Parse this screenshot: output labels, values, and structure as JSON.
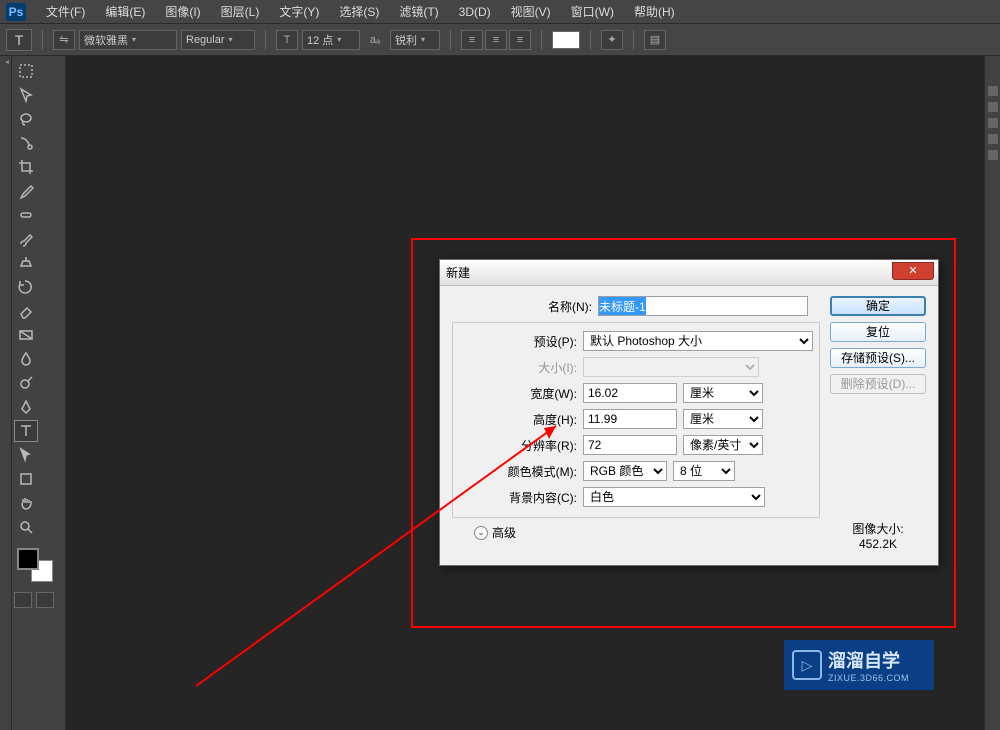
{
  "menubar": {
    "logo": "Ps",
    "items": [
      "文件(F)",
      "编辑(E)",
      "图像(I)",
      "图层(L)",
      "文字(Y)",
      "选择(S)",
      "滤镜(T)",
      "3D(D)",
      "视图(V)",
      "窗口(W)",
      "帮助(H)"
    ]
  },
  "optionsbar": {
    "tool_glyph": "T",
    "switch_glyph": "⇋",
    "font_family": "微软雅黑",
    "font_style": "Regular",
    "size_glyph": "T",
    "font_size": "12 点",
    "aa_label": "aₐ",
    "aa_value": "锐利",
    "color": "#ffffff"
  },
  "dialog": {
    "title": "新建",
    "close_glyph": "✕",
    "labels": {
      "name": "名称(N):",
      "preset": "预设(P):",
      "size": "大小(I):",
      "width": "宽度(W):",
      "height": "高度(H):",
      "res": "分辨率(R):",
      "mode": "颜色模式(M):",
      "bgfill": "背景内容(C):",
      "advanced": "高级",
      "img_size": "图像大小:"
    },
    "values": {
      "name": "未标题-1",
      "preset": "默认 Photoshop 大小",
      "width": "16.02",
      "width_unit": "厘米",
      "height": "11.99",
      "height_unit": "厘米",
      "res": "72",
      "res_unit": "像素/英寸",
      "mode": "RGB 颜色",
      "mode_depth": "8 位",
      "bgfill": "白色",
      "img_size": "452.2K"
    },
    "buttons": {
      "ok": "确定",
      "reset": "复位",
      "save": "存储预设(S)...",
      "delete": "删除预设(D)..."
    }
  },
  "watermark": {
    "cn": "溜溜自学",
    "en": "ZIXUE.3D66.COM",
    "play": "▷"
  }
}
